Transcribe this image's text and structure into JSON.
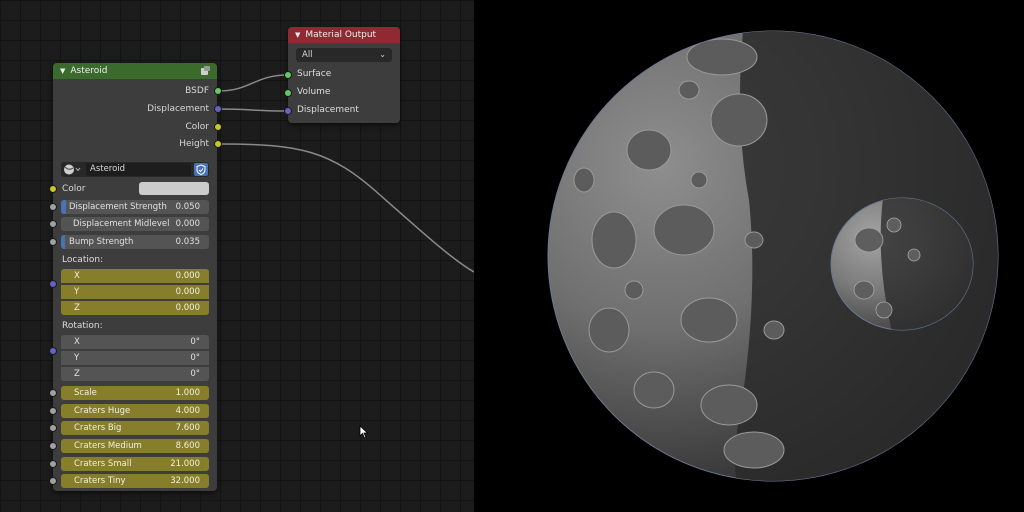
{
  "material_output": {
    "title": "Material Output",
    "target": "All",
    "inputs": [
      "Surface",
      "Volume",
      "Displacement"
    ]
  },
  "asteroid_node": {
    "title": "Asteroid",
    "outputs": [
      "BSDF",
      "Displacement",
      "Color",
      "Height"
    ],
    "datablock_name": "Asteroid",
    "color_label": "Color",
    "displacement_strength": {
      "label": "Displacement Strength",
      "value": "0.050"
    },
    "displacement_midlevel": {
      "label": "Displacement Midlevel",
      "value": "0.000"
    },
    "bump_strength": {
      "label": "Bump Strength",
      "value": "0.035"
    },
    "location": {
      "label": "Location:",
      "x": {
        "label": "X",
        "value": "0.000"
      },
      "y": {
        "label": "Y",
        "value": "0.000"
      },
      "z": {
        "label": "Z",
        "value": "0.000"
      }
    },
    "rotation": {
      "label": "Rotation:",
      "x": {
        "label": "X",
        "value": "0°"
      },
      "y": {
        "label": "Y",
        "value": "0°"
      },
      "z": {
        "label": "Z",
        "value": "0°"
      }
    },
    "scale": {
      "label": "Scale",
      "value": "1.000"
    },
    "craters_huge": {
      "label": "Craters Huge",
      "value": "4.000"
    },
    "craters_big": {
      "label": "Craters Big",
      "value": "7.600"
    },
    "craters_medium": {
      "label": "Craters Medium",
      "value": "8.600"
    },
    "craters_small": {
      "label": "Craters Small",
      "value": "21.000"
    },
    "craters_tiny": {
      "label": "Craters Tiny",
      "value": "32.000"
    }
  },
  "colors": {
    "material_output_header": "#8f2a33",
    "asteroid_header": "#3b6b2c",
    "node_body": "#3d3d3d",
    "socket_shader": "#63c763",
    "socket_vector": "#6363c7",
    "socket_color": "#c7c729",
    "socket_float": "#a1a1a1",
    "field_highlight": "#877e2c",
    "grid_background": "#1c1c1c"
  },
  "icons": {
    "node_header_icon": "node-group-icon",
    "datablock_icon": "sphere-material-icon",
    "fake_user_icon": "shield-check-icon",
    "cursor": "mouse-pointer-icon"
  }
}
